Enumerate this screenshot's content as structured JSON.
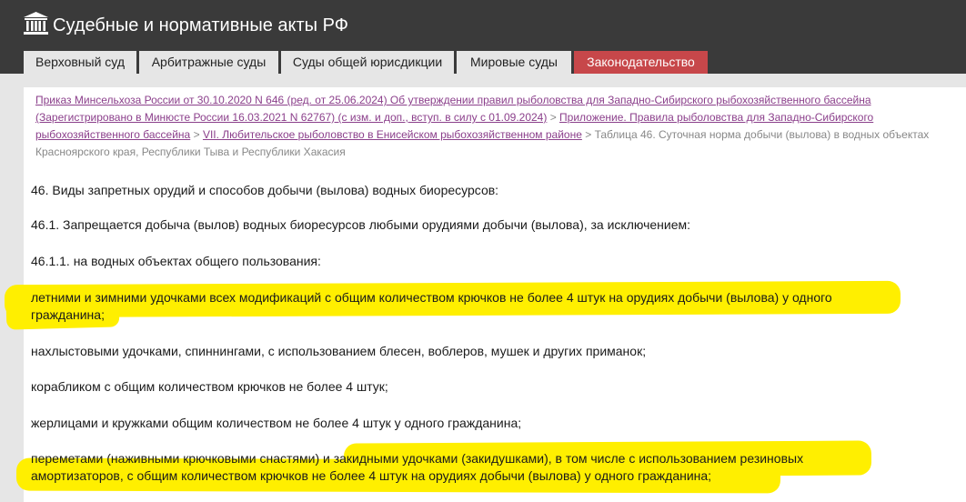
{
  "header": {
    "title": "Судебные и нормативные акты РФ",
    "logo_icon": "courthouse-icon",
    "bg_color": "#3a3a3a"
  },
  "nav": {
    "tabs": [
      {
        "label": "Верховный суд",
        "active": false
      },
      {
        "label": "Арбитражные суды",
        "active": false
      },
      {
        "label": "Суды общей юрисдикции",
        "active": false
      },
      {
        "label": "Мировые суды",
        "active": false
      },
      {
        "label": "Законодательство",
        "active": true
      }
    ],
    "active_color": "#c7474a"
  },
  "breadcrumb": {
    "link1_l1": "Приказ Минсельхоза России от 30.10.2020 N 646 (ред. от 25.06.2024) Об утверждении правил рыболовства для Западно-Сибирского рыбохозяйственного бассейна",
    "link1_l2": "(Зарегистрировано в Минюсте России 16.03.2021 N 62767) (с изм. и доп., вступ. в силу с 01.09.2024)",
    "separator": ">",
    "link2_l2": "Приложение. Правила рыболовства для Западно-Сибирского",
    "link2_l3": "рыбохозяйственного бассейна",
    "link3": "VII. Любительское рыболовство в Енисейском рыбохозяйственном районе",
    "current_l3": "Таблица 46. Суточная норма добычи (вылова) в водных объектах",
    "current_l4": "Красноярского края, Республики Тыва и Республики Хакасия"
  },
  "paragraphs": {
    "p1": "46. Виды запретных орудий и способов добычи (вылова) водных биоресурсов:",
    "p2": "46.1. Запрещается добыча (вылов) водных биоресурсов любыми орудиями добычи (вылова), за исключением:",
    "p3": "46.1.1. на водных объектах общего пользования:",
    "p4_l1": "летними и зимними удочками всех модификаций с общим количеством крючков не более 4 штук на орудиях добычи (вылова) у одного",
    "p4_l2": "гражданина;",
    "p5": "нахлыстовыми удочками, спиннингами, с использованием блесен, воблеров, мушек и других приманок;",
    "p6": "корабликом с общим количеством крючков не более 4 штук;",
    "p7": "жерлицами и кружками общим количеством не более 4 штук у одного гражданина;",
    "p8_l1": "переметами (наживными крючковыми снастями) и закидными удочками (закидушками), в том числе с использованием резиновых",
    "p8_l2": "амортизаторов, с общим количеством крючков не более 4 штук на орудиях добычи (вылова) у одного гражданина;"
  },
  "highlight_color": "#ffef00"
}
